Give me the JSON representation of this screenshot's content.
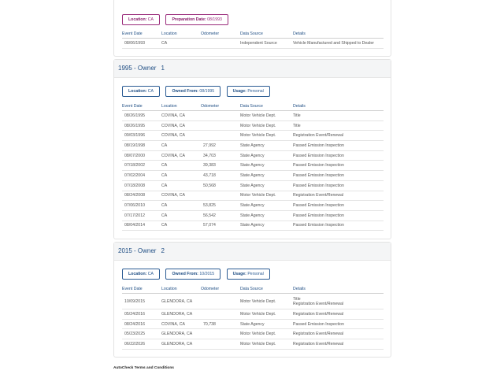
{
  "table_headers": {
    "date": "Event Date",
    "location": "Location",
    "odometer": "Odometer",
    "source": "Data Source",
    "details": "Details"
  },
  "sections": [
    {
      "badges": [
        {
          "label": "Location:",
          "value": "CA"
        },
        {
          "label": "Preparation Date:",
          "value": "08/1993"
        }
      ],
      "rows": [
        {
          "date": "08/06/1993",
          "location": "CA",
          "odometer": "",
          "source": "Independent Source",
          "details": [
            "Vehicle Manufactured and Shipped to Dealer"
          ]
        }
      ]
    },
    {
      "year": "1995",
      "title_sep": " - Owner",
      "owner_num": "1",
      "badges": [
        {
          "label": "Location:",
          "value": "CA"
        },
        {
          "label": "Owned From:",
          "value": "08/1995"
        },
        {
          "label": "Usage:",
          "value": "Personal"
        }
      ],
      "rows": [
        {
          "date": "08/26/1995",
          "location": "COVINA, CA",
          "odometer": "",
          "source": "Motor Vehicle Dept.",
          "details": [
            "Title"
          ]
        },
        {
          "date": "08/26/1995",
          "location": "COVINA, CA",
          "odometer": "",
          "source": "Motor Vehicle Dept.",
          "details": [
            "Title"
          ]
        },
        {
          "date": "09/03/1996",
          "location": "COVINA, CA",
          "odometer": "",
          "source": "Motor Vehicle Dept.",
          "details": [
            "Registration Event/Renewal"
          ]
        },
        {
          "date": "08/19/1998",
          "location": "CA",
          "odometer": "27,992",
          "source": "State Agency",
          "details": [
            "Passed Emission Inspection"
          ]
        },
        {
          "date": "08/07/2000",
          "location": "COVINA, CA",
          "odometer": "34,703",
          "source": "State Agency",
          "details": [
            "Passed Emission Inspection"
          ]
        },
        {
          "date": "07/18/2002",
          "location": "CA",
          "odometer": "39,383",
          "source": "State Agency",
          "details": [
            "Passed Emission Inspection"
          ]
        },
        {
          "date": "07/02/2004",
          "location": "CA",
          "odometer": "43,718",
          "source": "State Agency",
          "details": [
            "Passed Emission Inspection"
          ]
        },
        {
          "date": "07/18/2008",
          "location": "CA",
          "odometer": "50,568",
          "source": "State Agency",
          "details": [
            "Passed Emission Inspection"
          ]
        },
        {
          "date": "08/24/2008",
          "location": "COVINA, CA",
          "odometer": "",
          "source": "Motor Vehicle Dept.",
          "details": [
            "Registration Event/Renewal"
          ]
        },
        {
          "date": "07/06/2010",
          "location": "CA",
          "odometer": "53,825",
          "source": "State Agency",
          "details": [
            "Passed Emission Inspection"
          ]
        },
        {
          "date": "07/17/2012",
          "location": "CA",
          "odometer": "56,542",
          "source": "State Agency",
          "details": [
            "Passed Emission Inspection"
          ]
        },
        {
          "date": "08/04/2014",
          "location": "CA",
          "odometer": "57,074",
          "source": "State Agency",
          "details": [
            "Passed Emission Inspection"
          ]
        }
      ]
    },
    {
      "year": "2015",
      "title_sep": " - Owner",
      "owner_num": "2",
      "badges": [
        {
          "label": "Location:",
          "value": "CA"
        },
        {
          "label": "Owned From:",
          "value": "10/2015"
        },
        {
          "label": "Usage:",
          "value": "Personal"
        }
      ],
      "rows": [
        {
          "date": "10/09/2015",
          "location": "GLENDORA, CA",
          "odometer": "",
          "source": "Motor Vehicle Dept.",
          "details": [
            "Title",
            "Registration Event/Renewal"
          ]
        },
        {
          "date": "05/24/2016",
          "location": "GLENDORA, CA",
          "odometer": "",
          "source": "Motor Vehicle Dept.",
          "details": [
            "Registration Event/Renewal"
          ]
        },
        {
          "date": "08/24/2016",
          "location": "COVINA, CA",
          "odometer": "70,738",
          "source": "State Agency",
          "details": [
            "Passed Emission Inspection"
          ]
        },
        {
          "date": "05/23/2025",
          "location": "GLENDORA, CA",
          "odometer": "",
          "source": "Motor Vehicle Dept.",
          "details": [
            "Registration Event/Renewal"
          ]
        },
        {
          "date": "06/22/2026",
          "location": "GLENDORA, CA",
          "odometer": "",
          "source": "Motor Vehicle Dept.",
          "details": [
            "Registration Event/Renewal"
          ]
        }
      ]
    }
  ],
  "footer": {
    "terms_link": "AutoCheck Terms and Conditions"
  },
  "colors": {
    "accent": "#1f4e84",
    "badge_border": "#2a5b93",
    "highlight_badge": "#9a2b7b",
    "header_bg": "#f4f5f6"
  }
}
